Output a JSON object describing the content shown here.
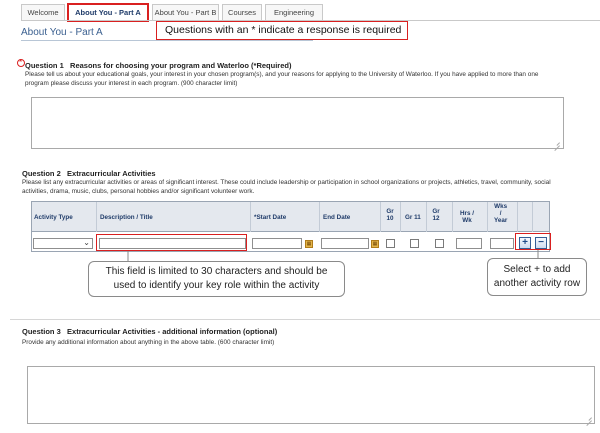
{
  "tabs": [
    "Welcome",
    "About You - Part A",
    "About You - Part B",
    "Courses",
    "Engineering"
  ],
  "banner": "Questions with an * indicate a response is required",
  "page_title": "About You - Part A",
  "required_marker": "*",
  "q1": {
    "label": "Question  1",
    "title": "Reasons for choosing your program and Waterloo (*Required)",
    "description": "Please tell us about your educational goals, your interest in your chosen program(s), and your reasons for applying to the University of Waterloo. If you have applied to more than one program please discuss your interest in each program.  (900 character limit)",
    "answer": ""
  },
  "q2": {
    "label": "Question  2",
    "title": "Extracurricular Activities",
    "description": "Please list any extracurricular activities or areas of significant interest. These could include leadership or participation in school organizations or projects, athletics, travel, community, social activities, drama, music, clubs, personal hobbies and/or significant volunteer work.",
    "columns": {
      "activity_type": "Activity Type",
      "description": "Description / Title",
      "start_date": "*Start Date",
      "end_date": "End Date",
      "gr10_a": "Gr",
      "gr10_b": "10",
      "gr11": "Gr 11",
      "gr12_a": "Gr",
      "gr12_b": "12",
      "hrs_a": "Hrs /",
      "hrs_b": "Wk",
      "wks_a": "Wks",
      "wks_b": "/",
      "wks_c": "Year"
    },
    "add_label": "+",
    "remove_label": "−"
  },
  "callouts": {
    "description_line1": "This field is limited to 30 characters and should be",
    "description_line2": "used to identify your key role within the activity",
    "add_line1": "Select + to add",
    "add_line2": "another activity row"
  },
  "q3": {
    "label": "Question  3",
    "title": "Extracurricular Activities - additional information (optional)",
    "description": "Provide any additional information about anything in the above table.  (600 character limit)",
    "answer": ""
  },
  "colors": {
    "accent_red": "#d92020",
    "title_blue": "#3a5f8f",
    "grid_header": "#e4e8ee"
  }
}
